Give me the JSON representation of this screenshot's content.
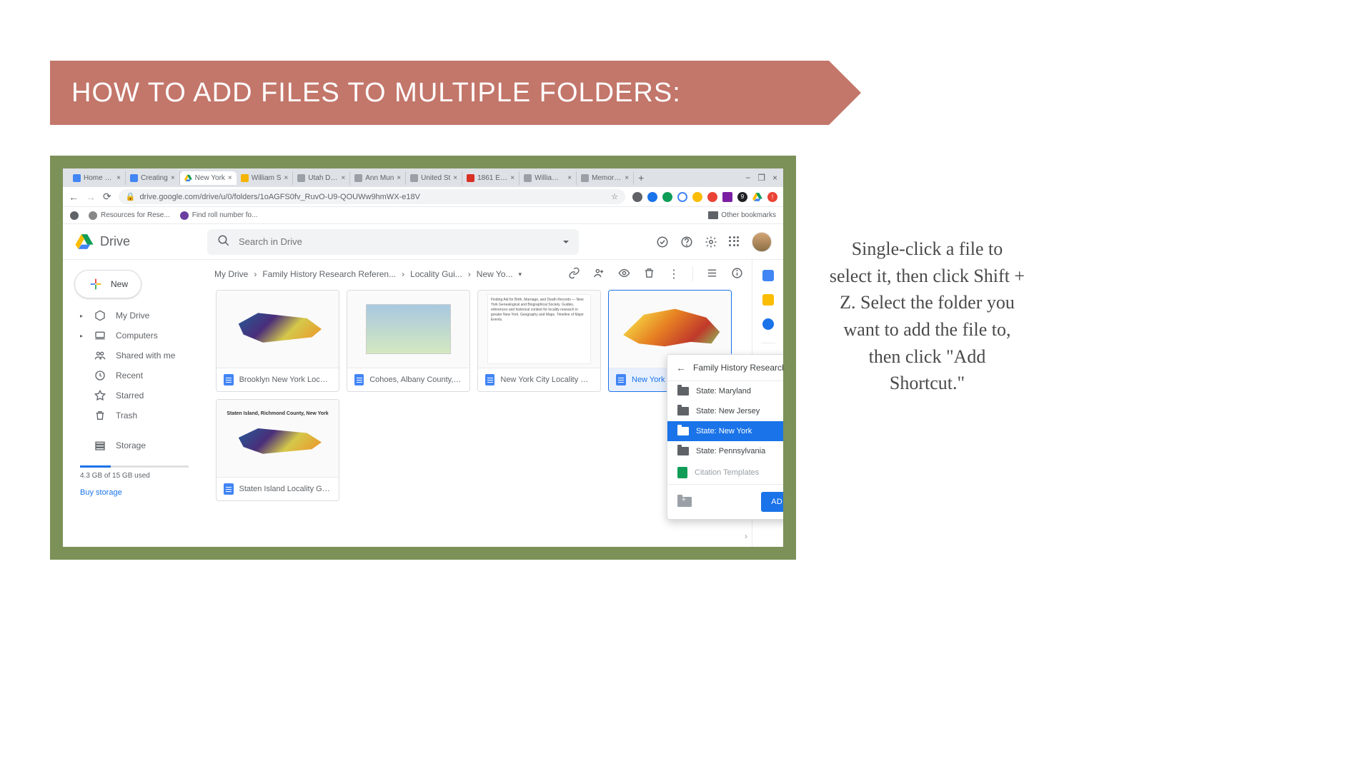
{
  "banner": {
    "title": "HOW TO ADD FILES TO MULTIPLE FOLDERS:"
  },
  "instruction": "Single-click a file to select it, then click Shift + Z.  Select the folder you want to add the file to, then click \"Add Shortcut.\"",
  "tabs": [
    {
      "label": "Home - C",
      "color": "#4285f4"
    },
    {
      "label": "Creating",
      "color": "#4285f4"
    },
    {
      "label": "New York",
      "color": "#0f9d58",
      "active": true
    },
    {
      "label": "William S",
      "color": "#f4b400"
    },
    {
      "label": "Utah Dea",
      "color": "#9aa0a6"
    },
    {
      "label": "Ann Mun",
      "color": "#9aa0a6"
    },
    {
      "label": "United St",
      "color": "#9aa0a6"
    },
    {
      "label": "1861 Eng",
      "color": "#d93025"
    },
    {
      "label": "William M",
      "color": "#9aa0a6"
    },
    {
      "label": "Memories",
      "color": "#9aa0a6"
    }
  ],
  "address": {
    "url": "drive.google.com/drive/u/0/folders/1oAGFS0fv_RuvO-U9-QOUWw9hmWX-e18V"
  },
  "bookmarks": [
    {
      "label": "Resources for Rese...",
      "color": "#888"
    },
    {
      "label": "Find roll number fo...",
      "color": "#6b3fa0"
    }
  ],
  "other_bookmarks": "Other bookmarks",
  "drive": {
    "name": "Drive"
  },
  "search": {
    "placeholder": "Search in Drive"
  },
  "nav": {
    "new": "New",
    "items": [
      {
        "label": "My Drive",
        "expandable": true,
        "icon": "mydrive"
      },
      {
        "label": "Computers",
        "expandable": true,
        "icon": "computers"
      },
      {
        "label": "Shared with me",
        "icon": "shared"
      },
      {
        "label": "Recent",
        "icon": "recent"
      },
      {
        "label": "Starred",
        "icon": "star"
      },
      {
        "label": "Trash",
        "icon": "trash"
      }
    ],
    "storage_label": "Storage",
    "storage_used": "4.3 GB of 15 GB used",
    "buy": "Buy storage"
  },
  "breadcrumb": [
    "My Drive",
    "Family History Research Referen...",
    "Locality Gui...",
    "New Yo..."
  ],
  "files": [
    {
      "name": "Brooklyn New York Locali...",
      "thumb": "map"
    },
    {
      "name": "Cohoes, Albany County, N...",
      "thumb": "map2"
    },
    {
      "name": "New York City Locality Gu...",
      "thumb": "doc"
    },
    {
      "name": "New York Locality Guide",
      "thumb": "nymap",
      "selected": true
    },
    {
      "name": "Staten Island Locality Gui...",
      "thumb": "map"
    }
  ],
  "staten_island_title": "Staten Island, Richmond County, New York",
  "picker": {
    "title": "Family History Research Referen...",
    "items": [
      {
        "label": "State: Maryland",
        "type": "folder"
      },
      {
        "label": "State: New Jersey",
        "type": "folder"
      },
      {
        "label": "State: New York",
        "type": "folder",
        "selected": true
      },
      {
        "label": "State: Pennsylvania",
        "type": "folder"
      },
      {
        "label": "Citation Templates",
        "type": "sheets"
      }
    ],
    "button": "ADD SHORTCUT"
  }
}
